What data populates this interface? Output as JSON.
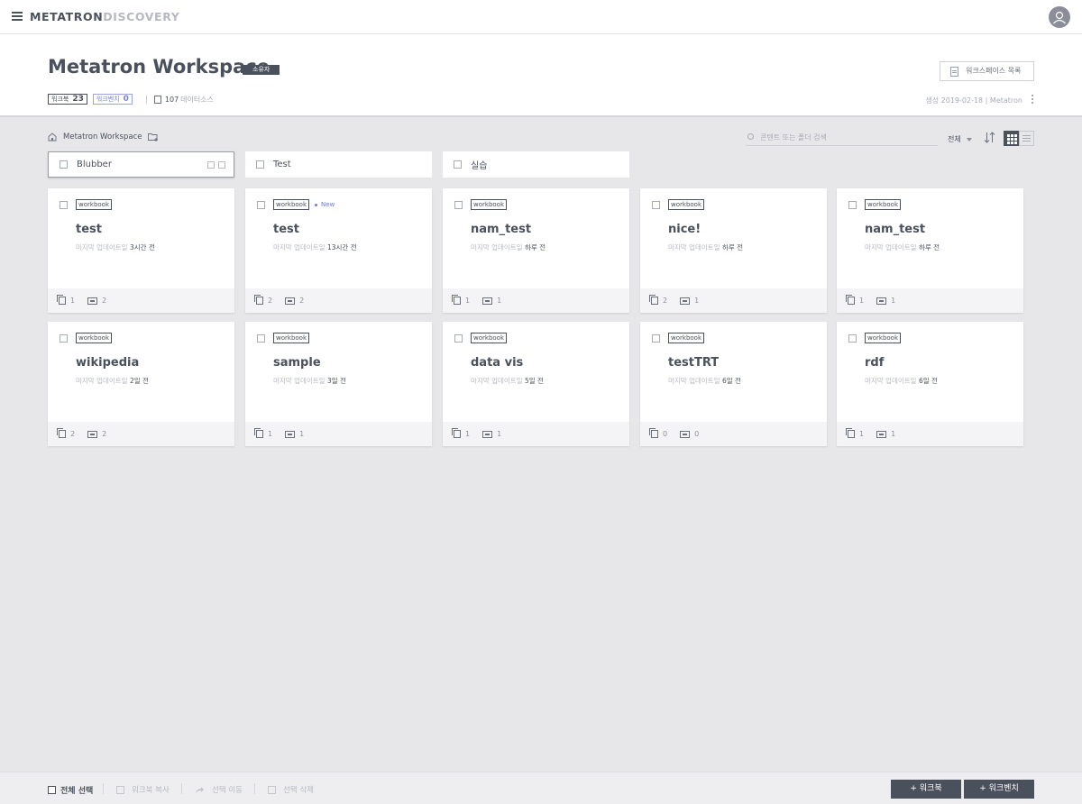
{
  "app": {
    "brand_main": "METATRON",
    "brand_sub": "DISCOVERY"
  },
  "header": {
    "title": "Metatron Workspace",
    "owner_badge": "소유자",
    "list_button": "워크스페이스 목록",
    "stats": {
      "workbook_label": "워크북",
      "workbook_count": "23",
      "workbench_label": "워크벤치",
      "workbench_count": "0",
      "datasource_count": "107",
      "datasource_label": "데이터소스"
    },
    "created": "생성 2019-02-18 | Metatron"
  },
  "toolbar": {
    "breadcrumb": "Metatron Workspace",
    "search_placeholder": "콘텐트 또는 폴더 검색",
    "filter_label": "전체"
  },
  "folders": [
    {
      "name": "Blubber"
    },
    {
      "name": "Test"
    },
    {
      "name": "실습"
    }
  ],
  "cards": [
    {
      "tag": "workbook",
      "title": "test",
      "updated_prefix": "마지막 업데이트일",
      "updated": "3시간 전",
      "new": "",
      "datasources": "1",
      "dashboards": "2"
    },
    {
      "tag": "workbook",
      "title": "test",
      "updated_prefix": "마지막 업데이트일",
      "updated": "13시간 전",
      "new": "New",
      "datasources": "2",
      "dashboards": "2"
    },
    {
      "tag": "workbook",
      "title": "nam_test",
      "updated_prefix": "마지막 업데이트일",
      "updated": "하루 전",
      "new": "",
      "datasources": "1",
      "dashboards": "1"
    },
    {
      "tag": "workbook",
      "title": "nice!",
      "updated_prefix": "마지막 업데이트일",
      "updated": "하루 전",
      "new": "",
      "datasources": "2",
      "dashboards": "1"
    },
    {
      "tag": "workbook",
      "title": "nam_test",
      "updated_prefix": "마지막 업데이트일",
      "updated": "하루 전",
      "new": "",
      "datasources": "1",
      "dashboards": "1"
    },
    {
      "tag": "workbook",
      "title": "wikipedia",
      "updated_prefix": "마지막 업데이트일",
      "updated": "2일 전",
      "new": "",
      "datasources": "2",
      "dashboards": "2"
    },
    {
      "tag": "workbook",
      "title": "sample",
      "updated_prefix": "마지막 업데이트일",
      "updated": "3일 전",
      "new": "",
      "datasources": "1",
      "dashboards": "1"
    },
    {
      "tag": "workbook",
      "title": "data vis",
      "updated_prefix": "마지막 업데이트일",
      "updated": "5일 전",
      "new": "",
      "datasources": "1",
      "dashboards": "1"
    },
    {
      "tag": "workbook",
      "title": "testTRT",
      "updated_prefix": "마지막 업데이트일",
      "updated": "6일 전",
      "new": "",
      "datasources": "0",
      "dashboards": "0"
    },
    {
      "tag": "workbook",
      "title": "rdf",
      "updated_prefix": "마지막 업데이트일",
      "updated": "6일 전",
      "new": "",
      "datasources": "1",
      "dashboards": "1"
    }
  ],
  "bottom": {
    "select_all": "전체 선택",
    "copy": "워크북 복사",
    "move": "선택 이동",
    "delete": "선택 삭제",
    "add_workbook": "+ 워크북",
    "add_workbench": "+ 워크벤치"
  }
}
